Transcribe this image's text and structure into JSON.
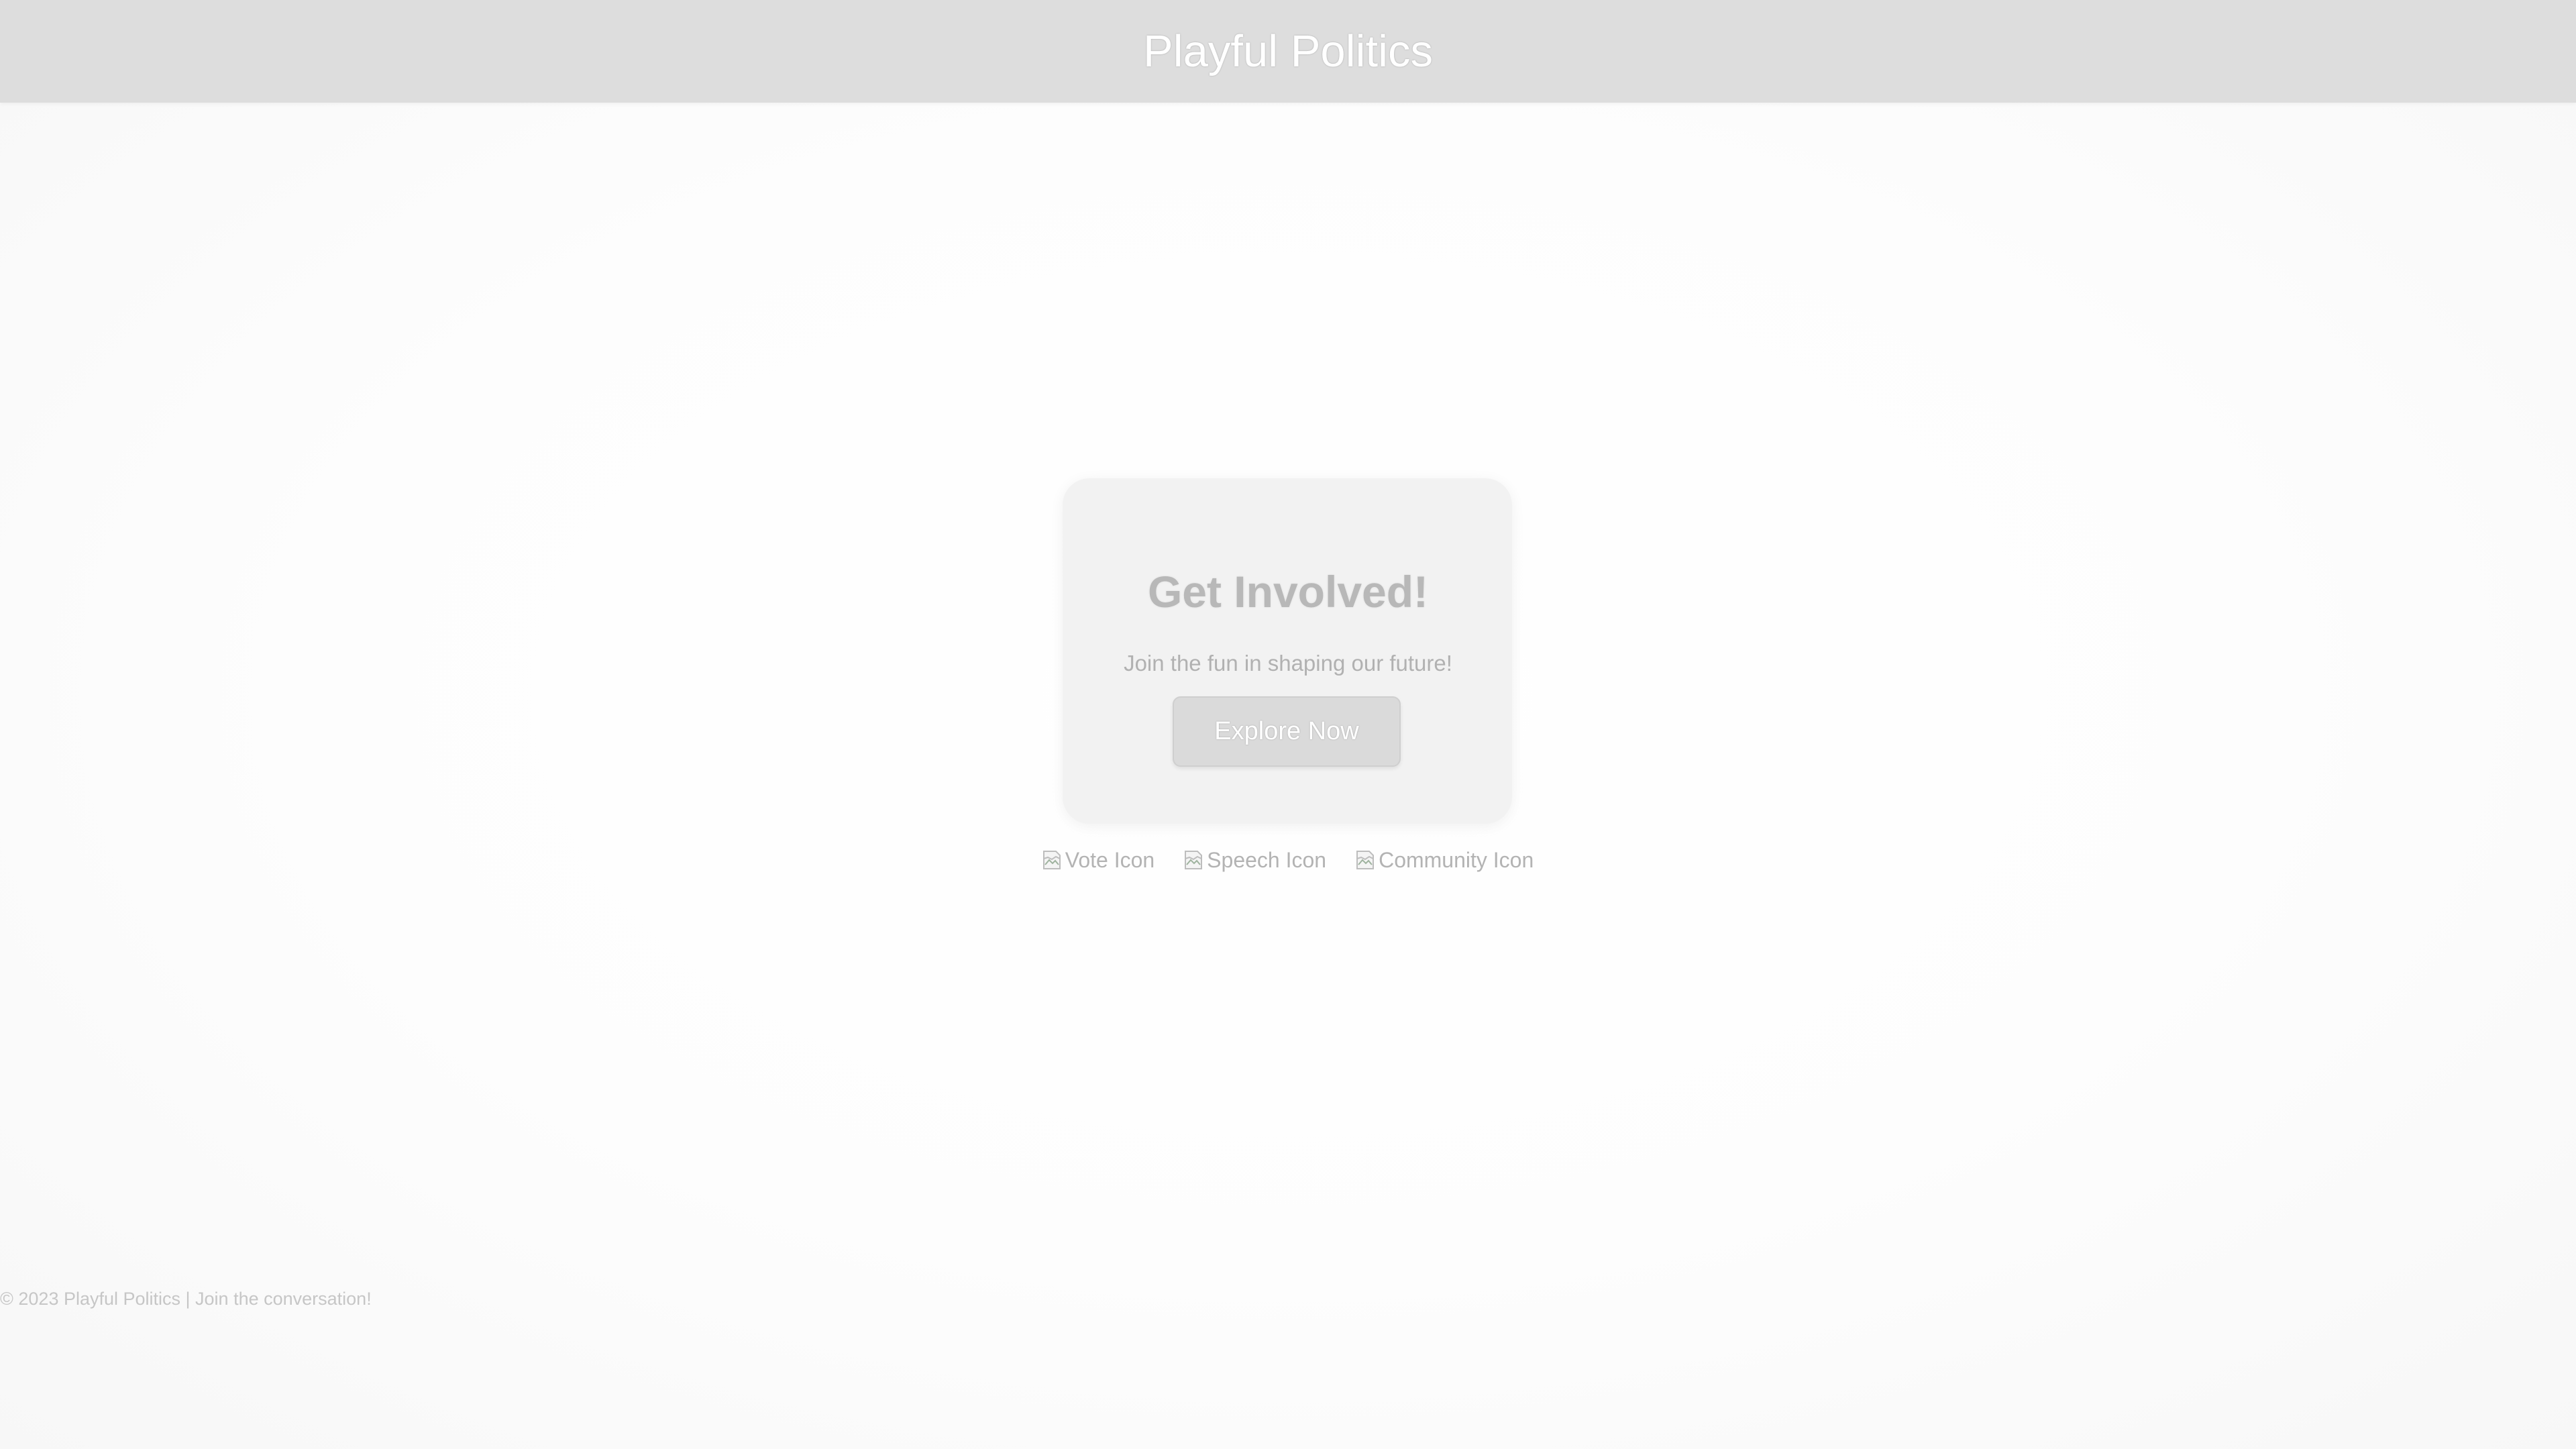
{
  "header": {
    "title": "Playful Politics"
  },
  "hero": {
    "title": "Get Involved!",
    "subtitle": "Join the fun in shaping our future!",
    "button_label": "Explore Now"
  },
  "icons": [
    {
      "alt": "Vote Icon",
      "icon": "broken-image-icon"
    },
    {
      "alt": "Speech Icon",
      "icon": "broken-image-icon"
    },
    {
      "alt": "Community Icon",
      "icon": "broken-image-icon"
    }
  ],
  "footer": {
    "text": "© 2023 Playful Politics | Join the conversation!"
  },
  "colors": {
    "header_bg": "#dddddd",
    "card_bg": "#f2f2f2",
    "button_bg": "#dadada",
    "page_bg": "#fcfcfc"
  }
}
